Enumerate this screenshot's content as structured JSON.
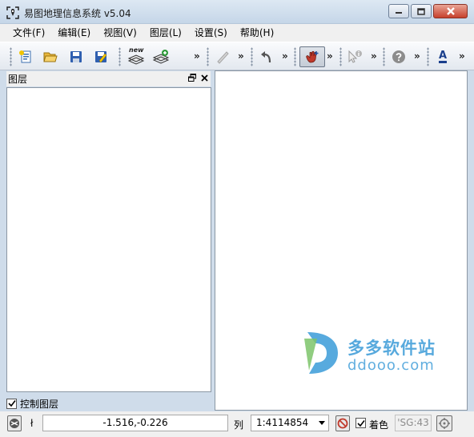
{
  "window": {
    "title": "易图地理信息系统 v5.04"
  },
  "menu": [
    {
      "label": "文件(F)"
    },
    {
      "label": "编辑(E)"
    },
    {
      "label": "视图(V)"
    },
    {
      "label": "图层(L)"
    },
    {
      "label": "设置(S)"
    },
    {
      "label": "帮助(H)"
    }
  ],
  "toolbar": {
    "new_label": "new",
    "more": "»",
    "text_icon_label": "A"
  },
  "layers_panel": {
    "title": "图层",
    "control_label": "控制图层",
    "control_checked": true
  },
  "statusbar": {
    "cursor_marker": "ł",
    "coordinates": "-1.516,-0.226",
    "column_label": "列",
    "scale": "1:4114854",
    "color_label": "着色",
    "color_checked": true,
    "sg_value": "'SG:43"
  },
  "watermark": {
    "cn_text": "多多软件站",
    "url_text": "ddooo.com",
    "accent": "#3a9bd8"
  }
}
